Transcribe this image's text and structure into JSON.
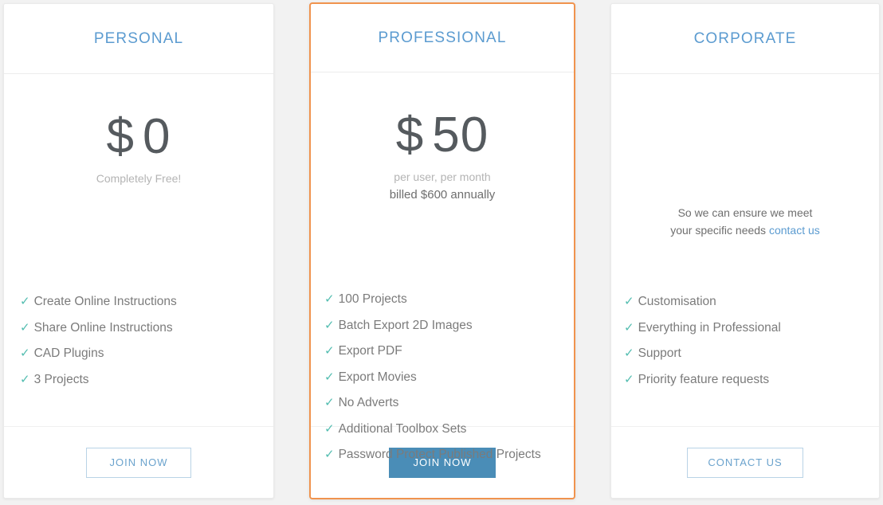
{
  "plans": [
    {
      "id": "personal",
      "title": "PERSONAL",
      "price_currency": "$",
      "price_amount": "0",
      "price_sub": "Completely Free!",
      "features": [
        "Create Online Instructions",
        "Share Online Instructions",
        "CAD Plugins",
        "3 Projects"
      ],
      "cta_label": "JOIN NOW"
    },
    {
      "id": "professional",
      "title": "PROFESSIONAL",
      "price_currency": "$",
      "price_amount": "50",
      "price_sub": "per user, per month",
      "price_sub2": "billed $600 annually",
      "features": [
        "100 Projects",
        "Batch Export 2D Images",
        "Export PDF",
        "Export Movies",
        "No Adverts",
        "Additional Toolbox Sets",
        "Password Protect Published Projects"
      ],
      "cta_label": "JOIN NOW"
    },
    {
      "id": "corporate",
      "title": "CORPORATE",
      "description_line1": "So we can ensure we meet",
      "description_line2": "your specific needs",
      "description_link": "contact us",
      "features": [
        "Customisation",
        "Everything in Professional",
        "Support",
        "Priority feature requests"
      ],
      "cta_label": "CONTACT US"
    }
  ],
  "icons": {
    "check": "✓"
  },
  "colors": {
    "title_blue": "#5b9bd0",
    "check_teal": "#53bdb0",
    "highlight_orange": "#f0934e",
    "button_blue": "#4a8db7",
    "page_background": "#f2f2f2"
  }
}
